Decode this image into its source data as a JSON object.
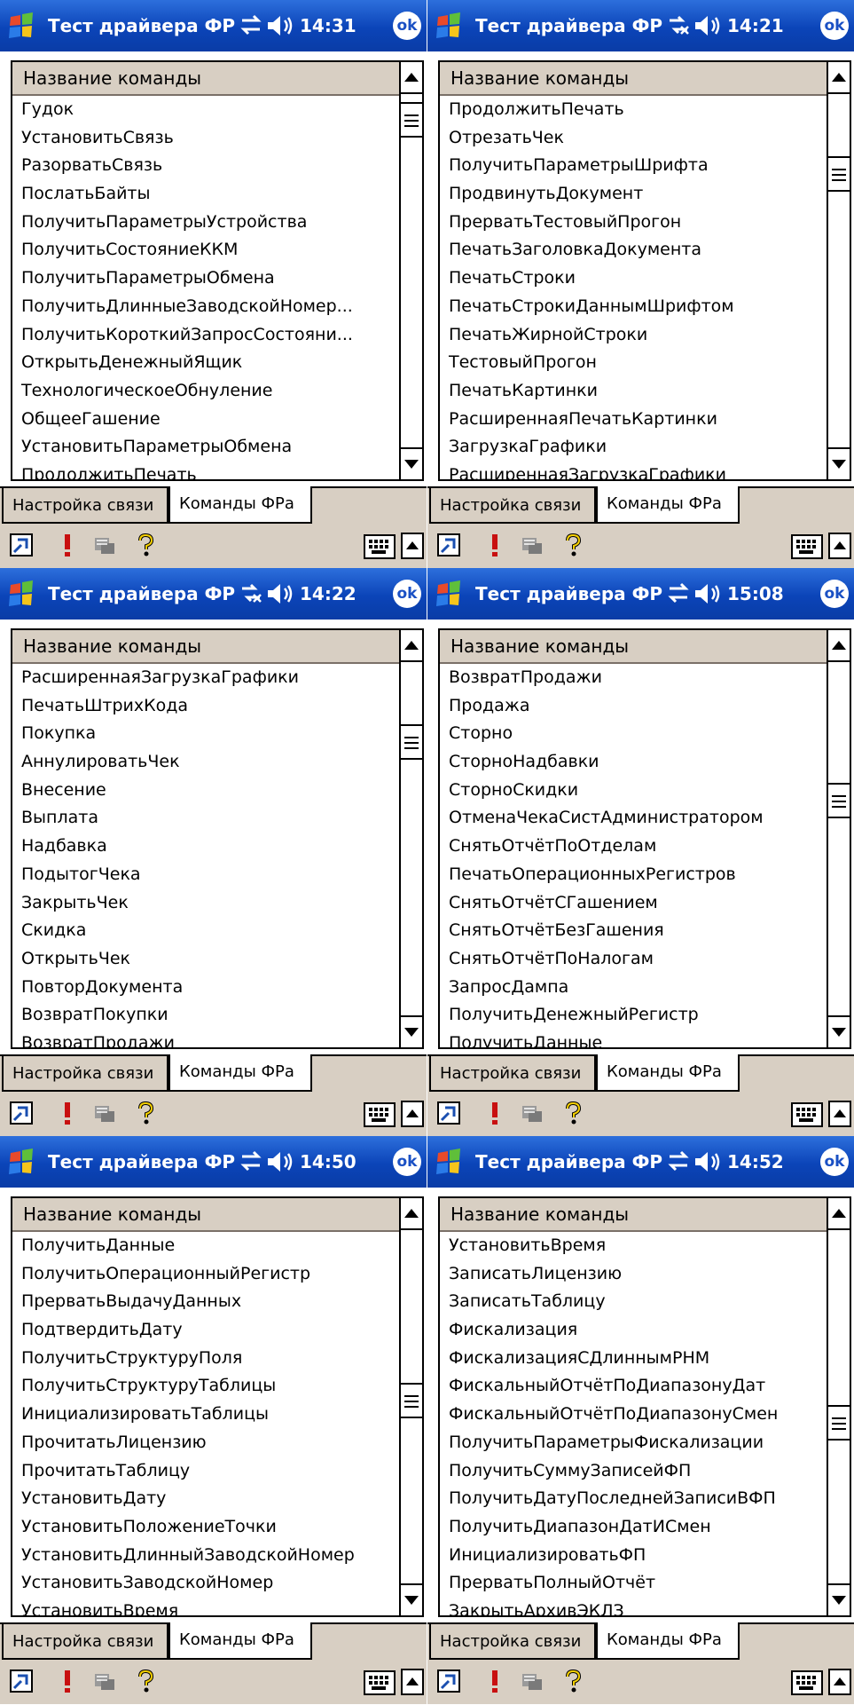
{
  "title": "Тест драйвера ФР",
  "column_header": "Название команды",
  "tabs": [
    "Настройка связи",
    "Команды ФРа"
  ],
  "ok_label": "ok",
  "screens": [
    {
      "time": "14:31",
      "conn_icon": "connection-arrows-icon",
      "thumb_pos": 0.03,
      "items": [
        "Гудок",
        "УстановитьСвязь",
        "РазорватьСвязь",
        "ПослатьБайты",
        "ПолучитьПараметрыУстройства",
        "ПолучитьСостояниеККМ",
        "ПолучитьПараметрыОбмена",
        "ПолучитьДлинныеЗаводскойНомер...",
        "ПолучитьКороткийЗапросСостояни...",
        "ОткрытьДенежныйЯщик",
        "ТехнологическоеОбнуление",
        "ОбщееГашение",
        "УстановитьПараметрыОбмена",
        "ПродолжитьПечать"
      ]
    },
    {
      "time": "14:21",
      "conn_icon": "connection-disconnected-icon",
      "thumb_pos": 0.2,
      "items": [
        "ПродолжитьПечать",
        "ОтрезатьЧек",
        "ПолучитьПараметрыШрифта",
        "ПродвинутьДокумент",
        "ПрерватьТестовыйПрогон",
        "ПечатьЗаголовкаДокумента",
        "ПечатьСтроки",
        "ПечатьСтрокиДаннымШрифтом",
        "ПечатьЖирнойСтроки",
        "ТестовыйПрогон",
        "ПечатьКартинки",
        "РасширеннаяПечатьКартинки",
        "ЗагрузкаГрафики",
        "РасширеннаяЗагрузкаГрафики"
      ]
    },
    {
      "time": "14:22",
      "conn_icon": "connection-disconnected-icon",
      "thumb_pos": 0.2,
      "items": [
        "РасширеннаяЗагрузкаГрафики",
        "ПечатьШтрихКода",
        "Покупка",
        "АннулироватьЧек",
        "Внесение",
        "Выплата",
        "Надбавка",
        "ПодытогЧека",
        "ЗакрытьЧек",
        "Скидка",
        "ОткрытьЧек",
        "ПовторДокумента",
        "ВозвратПокупки",
        "ВозвратПродажи"
      ]
    },
    {
      "time": "15:08",
      "conn_icon": "connection-arrows-icon",
      "thumb_pos": 0.38,
      "items": [
        "ВозвратПродажи",
        "Продажа",
        "Сторно",
        "СторноНадбавки",
        "СторноСкидки",
        "ОтменаЧекаСистАдминистратором",
        "СнятьОтчётПоОтделам",
        "ПечатьОперационныхРегистров",
        "СнятьОтчётСГашением",
        "СнятьОтчётБезГашения",
        "СнятьОтчётПоНалогам",
        "ЗапросДампа",
        "ПолучитьДенежныйРегистр",
        "ПолучитьДанные"
      ]
    },
    {
      "time": "14:50",
      "conn_icon": "connection-arrows-icon",
      "thumb_pos": 0.48,
      "items": [
        "ПолучитьДанные",
        "ПолучитьОперационныйРегистр",
        "ПрерватьВыдачуДанных",
        "ПодтвердитьДату",
        "ПолучитьСтруктуруПоля",
        "ПолучитьСтруктуруТаблицы",
        "ИнициализироватьТаблицы",
        "ПрочитатьЛицензию",
        "ПрочитатьТаблицу",
        "УстановитьДату",
        "УстановитьПоложениеТочки",
        "УстановитьДлинныйЗаводскойНомер",
        "УстановитьЗаводскойНомер",
        "УстановитьВремя"
      ]
    },
    {
      "time": "14:52",
      "conn_icon": "connection-arrows-icon",
      "thumb_pos": 0.55,
      "items": [
        "УстановитьВремя",
        "ЗаписатьЛицензию",
        "ЗаписатьТаблицу",
        "Фискализация",
        "ФискализацияСДлиннымРНМ",
        "ФискальныйОтчётПоДиапазонуДат",
        "ФискальныйОтчётПоДиапазонуСмен",
        "ПолучитьПараметрыФискализации",
        "ПолучитьСуммуЗаписейФП",
        "ПолучитьДатуПоследнейЗаписиВФП",
        "ПолучитьДиапазонДатИСмен",
        "ИнициализироватьФП",
        "ПрерватьПолныйОтчёт",
        "ЗакрытьАрхивЭКЛЗ"
      ]
    }
  ]
}
